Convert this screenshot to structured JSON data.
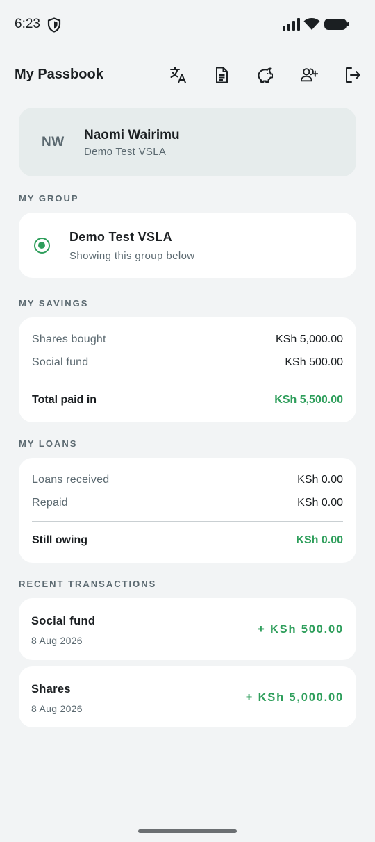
{
  "status_bar": {
    "time": "6:23"
  },
  "app_bar": {
    "title": "My Passbook",
    "actions": [
      "translate-icon",
      "document-icon",
      "piggy-bank-icon",
      "add-member-icon",
      "logout-icon"
    ]
  },
  "profile": {
    "initials": "NW",
    "name": "Naomi Wairimu",
    "group": "Demo Test VSLA"
  },
  "my_group": {
    "section_title": "MY GROUP",
    "name": "Demo Test VSLA",
    "subtitle": "Showing this group below"
  },
  "savings": {
    "section_title": "MY SAVINGS",
    "rows": [
      {
        "label": "Shares bought",
        "value": "KSh 5,000.00"
      },
      {
        "label": "Social fund",
        "value": "KSh 500.00"
      }
    ],
    "total_label": "Total paid in",
    "total_value": "KSh 5,500.00"
  },
  "loans": {
    "section_title": "MY LOANS",
    "rows": [
      {
        "label": "Loans received",
        "value": "KSh 0.00"
      },
      {
        "label": "Repaid",
        "value": "KSh 0.00"
      }
    ],
    "total_label": "Still owing",
    "total_value": "KSh 0.00"
  },
  "transactions": {
    "section_title": "RECENT TRANSACTIONS",
    "items": [
      {
        "title": "Social fund",
        "date": "8 Aug 2026",
        "amount": "+ KSh 500.00"
      },
      {
        "title": "Shares",
        "date": "8 Aug 2026",
        "amount": "+ KSh 5,000.00"
      }
    ]
  },
  "colors": {
    "accent_green": "#2e9e5b",
    "background": "#f2f4f5",
    "profile_card": "#e6ecec",
    "muted_text": "#5b6970"
  }
}
